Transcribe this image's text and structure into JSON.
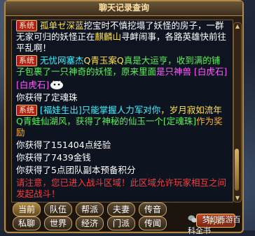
{
  "window": {
    "title": "聊天记录查询"
  },
  "log": [
    {
      "type": "system",
      "tag": "系统",
      "segments": [
        {
          "text": "孤单ゼ深蓝",
          "color": "#ffe24a"
        },
        {
          "text": "挖宝时不慎挖塌了妖怪的房子，一群无家可归的妖怪正在",
          "color": "#ffffff"
        },
        {
          "text": "麒麟山",
          "color": "#ffe24a"
        },
        {
          "text": "寻衅闹事，各路英雄快前往平乱啊！",
          "color": "#ffffff"
        }
      ]
    },
    {
      "type": "system",
      "tag": "系统",
      "segments": [
        {
          "text": "无忧网塞杰",
          "color": "#3ff2ff"
        },
        {
          "text": "Q青玉案Q",
          "color": "#ffe24a"
        },
        {
          "text": "真是大运亨，收到满的铺子包裹了一只神奇的妖怪，原来里面",
          "color": "#5af35a"
        },
        {
          "text": "是只神兽 [白虎石]",
          "color": "#ff5cff"
        }
      ]
    },
    {
      "type": "plain",
      "segments": [
        {
          "text": "[白虎石]",
          "color": "#ff5cff"
        }
      ]
    },
    {
      "type": "plain",
      "segments": [
        {
          "text": "你获得了定魂珠",
          "color": "#ffffff"
        }
      ]
    },
    {
      "type": "system",
      "tag": "系统",
      "segments": [
        {
          "text": "[福娃生出]只能掌握人力军对你",
          "color": "#3ff2ff"
        },
        {
          "text": "，岁月寂如流年",
          "color": "#ffe24a"
        },
        {
          "text": "Q青蛙仙湖风，获得了神秘的仙玉一个[定魂珠]",
          "color": "#5af35a"
        },
        {
          "text": "作为奖励",
          "color": "#ffb02e"
        }
      ]
    },
    {
      "type": "plain",
      "segments": [
        {
          "text": "你获得了151404点经验",
          "color": "#ffffff"
        }
      ]
    },
    {
      "type": "plain",
      "segments": [
        {
          "text": "你获得了7439金钱",
          "color": "#ffffff"
        }
      ]
    },
    {
      "type": "plain",
      "segments": [
        {
          "text": "你获得了5点团队副本预备积分",
          "color": "#ffffff"
        }
      ]
    },
    {
      "type": "plain",
      "segments": [
        {
          "text": "请注意，您已进入战斗区域！此区域允许玩家相互之间发起战斗！",
          "color": "#ff3b3b"
        }
      ]
    }
  ],
  "tabs_row1": [
    "当前",
    "队伍",
    "帮派",
    "夫妻",
    "传音"
  ],
  "tabs_row2": [
    "私聊",
    "世界",
    "经济",
    "门派",
    "传闻"
  ],
  "refresh_label": "刷新",
  "watermark": "梦幻西游百科全书",
  "colors": {
    "accent_gold": "#b58a45",
    "tag_red": "#b11c1c",
    "log_bg": "#0a1223"
  }
}
